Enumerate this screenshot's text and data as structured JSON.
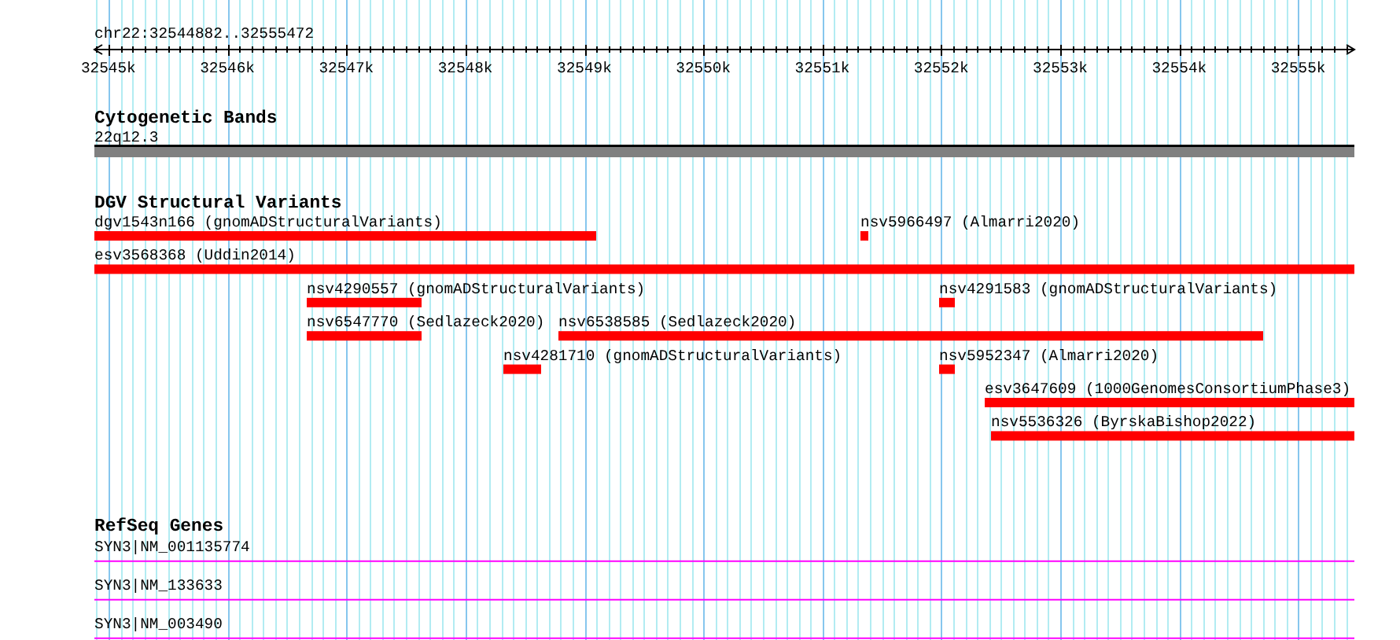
{
  "region": {
    "label": "chr22:32544882..32555472"
  },
  "ruler": {
    "ticks": [
      {
        "label": "32545k"
      },
      {
        "label": "32546k"
      },
      {
        "label": "32547k"
      },
      {
        "label": "32548k"
      },
      {
        "label": "32549k"
      },
      {
        "label": "32550k"
      },
      {
        "label": "32551k"
      },
      {
        "label": "32552k"
      },
      {
        "label": "32553k"
      },
      {
        "label": "32554k"
      },
      {
        "label": "32555k"
      }
    ]
  },
  "tracks": [
    {
      "kind": "cytoband",
      "title": "Cytogenetic Bands",
      "bands": [
        {
          "label": "22q12.3"
        }
      ]
    },
    {
      "kind": "variants",
      "title": "DGV Structural Variants",
      "rows": [
        [
          {
            "label": "dgv1543n166 (gnomADStructuralVariants)"
          },
          {
            "label": "nsv5966497 (Almarri2020)"
          }
        ],
        [
          {
            "label": "esv3568368 (Uddin2014)"
          }
        ],
        [
          {
            "label": "nsv4290557 (gnomADStructuralVariants)"
          },
          {
            "label": "nsv4291583 (gnomADStructuralVariants)"
          }
        ],
        [
          {
            "label": "nsv6547770 (Sedlazeck2020)"
          },
          {
            "label": "nsv6538585 (Sedlazeck2020)"
          }
        ],
        [
          {
            "label": "nsv4281710 (gnomADStructuralVariants)"
          },
          {
            "label": "nsv5952347 (Almarri2020)"
          }
        ],
        [
          {
            "label": "esv3647609 (1000GenomesConsortiumPhase3)"
          }
        ],
        [
          {
            "label": "nsv5536326 (ByrskaBishop2022)"
          }
        ]
      ]
    },
    {
      "kind": "genes",
      "title": "RefSeq Genes",
      "genes": [
        {
          "label": "SYN3|NM_001135774"
        },
        {
          "label": "SYN3|NM_133633"
        },
        {
          "label": "SYN3|NM_003490"
        }
      ]
    }
  ]
}
